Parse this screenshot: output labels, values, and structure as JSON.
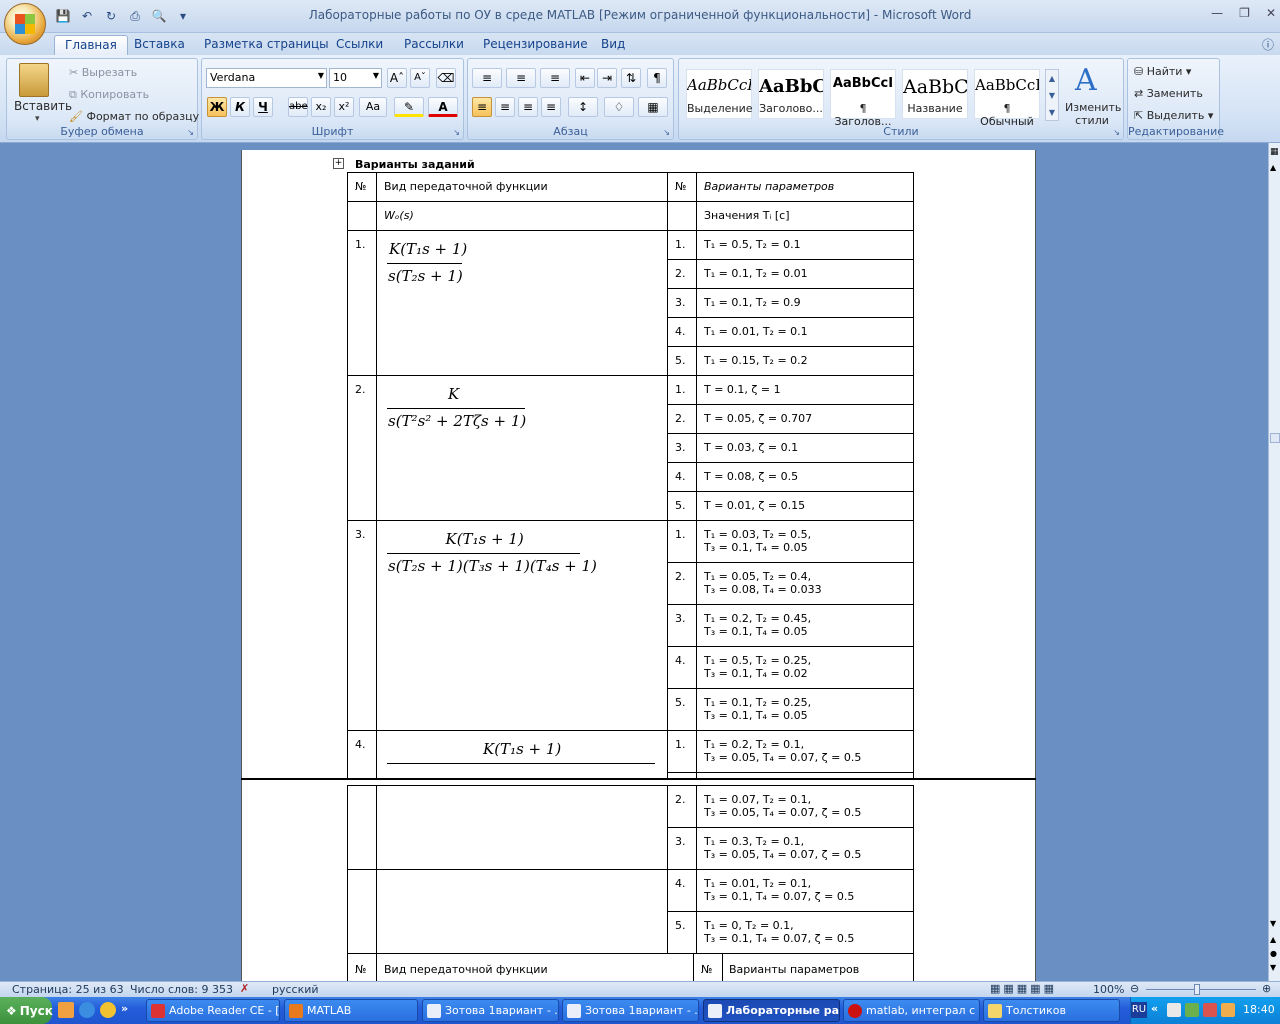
{
  "window": {
    "title": "Лабораторные работы по ОУ в среде MATLAB [Режим ограниченной функциональности] - Microsoft Word"
  },
  "tabs": [
    "Главная",
    "Вставка",
    "Разметка страницы",
    "Ссылки",
    "Рассылки",
    "Рецензирование",
    "Вид"
  ],
  "clipboard": {
    "paste": "Вставить",
    "cut": "Вырезать",
    "copy": "Копировать",
    "format_painter": "Формат по образцу",
    "label": "Буфер обмена"
  },
  "font": {
    "name": "Verdana",
    "size": "10",
    "label": "Шрифт",
    "bold": "Ж",
    "italic": "К",
    "underline": "Ч",
    "strike": "abe",
    "sub": "x₂",
    "sup": "x²",
    "case": "Aa"
  },
  "paragraph": {
    "label": "Абзац"
  },
  "styles": {
    "label": "Стили",
    "items": [
      {
        "preview": "AaBbCcI",
        "name": "Выделение"
      },
      {
        "preview": "AaBbC",
        "name": "Заголово..."
      },
      {
        "preview": "AaBbCcI",
        "name": "¶ Заголов..."
      },
      {
        "preview": "AaBbC",
        "name": "Название"
      },
      {
        "preview": "AaBbCcI",
        "name": "¶ Обычный"
      }
    ],
    "change": "Изменить стили"
  },
  "editing": {
    "label": "Редактирование",
    "find": "Найти",
    "replace": "Заменить",
    "select": "Выделить"
  },
  "doc": {
    "heading": "Варианты заданий",
    "col_num": "№",
    "col_kind": "Вид передаточной функции",
    "col_num2": "№",
    "col_params": "Варианты параметров",
    "sub_kind": "Wₒ(s)",
    "sub_params": "Значения Tᵢ [с]",
    "rows": [
      {
        "n": "1.",
        "num": "K(T₁s + 1)",
        "den": "s(T₂s + 1)",
        "variants": [
          "T₁ = 0.5, T₂ = 0.1",
          "T₁ = 0.1, T₂ = 0.01",
          "T₁ = 0.1, T₂ = 0.9",
          "T₁ = 0.01, T₂ = 0.1",
          "T₁ = 0.15, T₂ = 0.2"
        ]
      },
      {
        "n": "2.",
        "num": "K",
        "den": "s(T²s² + 2Tζs + 1)",
        "variants": [
          "T = 0.1, ζ = 1",
          "T = 0.05, ζ = 0.707",
          "T = 0.03, ζ = 0.1",
          "T = 0.08, ζ = 0.5",
          "T = 0.01, ζ = 0.15"
        ]
      },
      {
        "n": "3.",
        "num": "K(T₁s + 1)",
        "den": "s(T₂s + 1)(T₃s + 1)(T₄s + 1)",
        "variants": [
          [
            "T₁ = 0.03, T₂ = 0.5,",
            "T₃ = 0.1, T₄ = 0.05"
          ],
          [
            "T₁ = 0.05, T₂ = 0.4,",
            "T₃ = 0.08, T₄ = 0.033"
          ],
          [
            "T₁ = 0.2, T₂ = 0.45,",
            "T₃ = 0.1, T₄ = 0.05"
          ],
          [
            "T₁ = 0.5, T₂ = 0.25,",
            "T₃ = 0.1, T₄ = 0.02"
          ],
          [
            "T₁ = 0.1, T₂ = 0.25,",
            "T₃ = 0.1, T₄ = 0.05"
          ]
        ]
      },
      {
        "n": "4.",
        "num": "K(T₁s + 1)",
        "variants": [
          [
            "T₁ = 0.2, T₂ = 0.1,",
            "T₃ = 0.05, T₄ = 0.07, ζ = 0.5"
          ],
          [
            "T₁ = 0.07, T₂ = 0.1,",
            "T₃ = 0.05, T₄ = 0.07, ζ = 0.5"
          ],
          [
            "T₁ = 0.3, T₂ = 0.1,",
            "T₃ = 0.05, T₄ = 0.07, ζ = 0.5"
          ],
          [
            "T₁ = 0.01, T₂ = 0.1,",
            "T₃ = 0.1, T₄ = 0.07, ζ = 0.5"
          ],
          [
            "T₁ = 0, T₂ = 0.1,",
            "T₃ = 0.1, T₄ = 0.07, ζ = 0.5"
          ]
        ]
      }
    ]
  },
  "variant_numbers": [
    "1.",
    "2.",
    "3.",
    "4.",
    "5."
  ],
  "status": {
    "page": "Страница: 25 из 63",
    "words": "Число слов: 9 353",
    "lang": "русский",
    "zoom": "100%"
  },
  "taskbar": {
    "start": "Пуск",
    "items": [
      "Adobe Reader CE - [...",
      "MATLAB",
      "Зотова 1вариант - ...",
      "Зотова 1вариант - ...",
      "Лабораторные ра...",
      "matlab, интеграл с ...",
      "Толстиков"
    ],
    "lang": "RU",
    "time": "18:40"
  }
}
